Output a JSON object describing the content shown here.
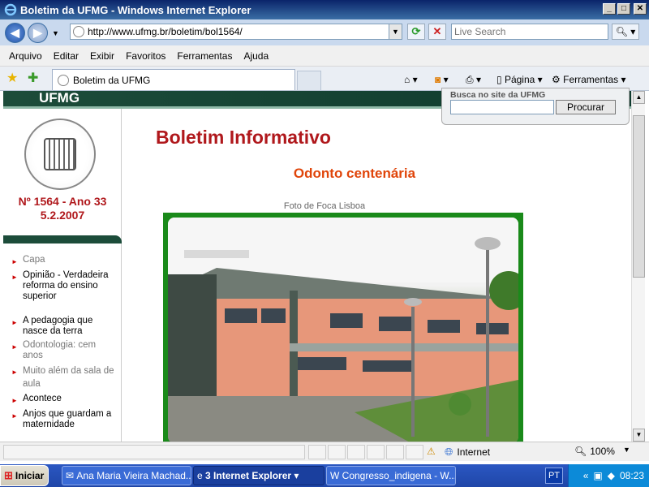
{
  "window": {
    "title": "Boletim da UFMG - Windows Internet Explorer"
  },
  "address_bar": {
    "url": "http://www.ufmg.br/boletim/bol1564/",
    "search_placeholder": "Live Search"
  },
  "menu": [
    "Arquivo",
    "Editar",
    "Exibir",
    "Favoritos",
    "Ferramentas",
    "Ajuda"
  ],
  "tab": {
    "title": "Boletim da UFMG"
  },
  "toolbar": {
    "page_label": "Página",
    "tools_label": "Ferramentas"
  },
  "page": {
    "brand": "UFMG",
    "site_search": {
      "label": "Busca no site da UFMG",
      "button": "Procurar"
    },
    "issue": {
      "number": "Nº 1564 - Ano 33",
      "date": "5.2.2007"
    },
    "title": "Boletim Informativo",
    "subtitle": "Odonto centenária",
    "photo_credit": "Foto de Foca Lisboa",
    "nav": [
      {
        "label": "Capa",
        "visited": true
      },
      {
        "label": "Opinião - Verdadeira reforma do ensino superior",
        "visited": false
      },
      {
        "label": "A pedagogia que nasce da terra",
        "visited": false
      },
      {
        "label": "Odontologia: cem anos",
        "visited": true
      },
      {
        "label": "Muito além da sala de aula",
        "visited": true
      },
      {
        "label": "Acontece",
        "visited": false
      },
      {
        "label": "Anjos que guardam a maternidade",
        "visited": false
      }
    ]
  },
  "status": {
    "zone": "Internet",
    "zoom": "100%"
  },
  "taskbar": {
    "start": "Iniciar",
    "tasks": [
      "Ana Maria Vieira Machad...",
      "3 Internet Explorer",
      "Congresso_indigena - W..."
    ],
    "lang": "PT",
    "clock": "08:23"
  }
}
